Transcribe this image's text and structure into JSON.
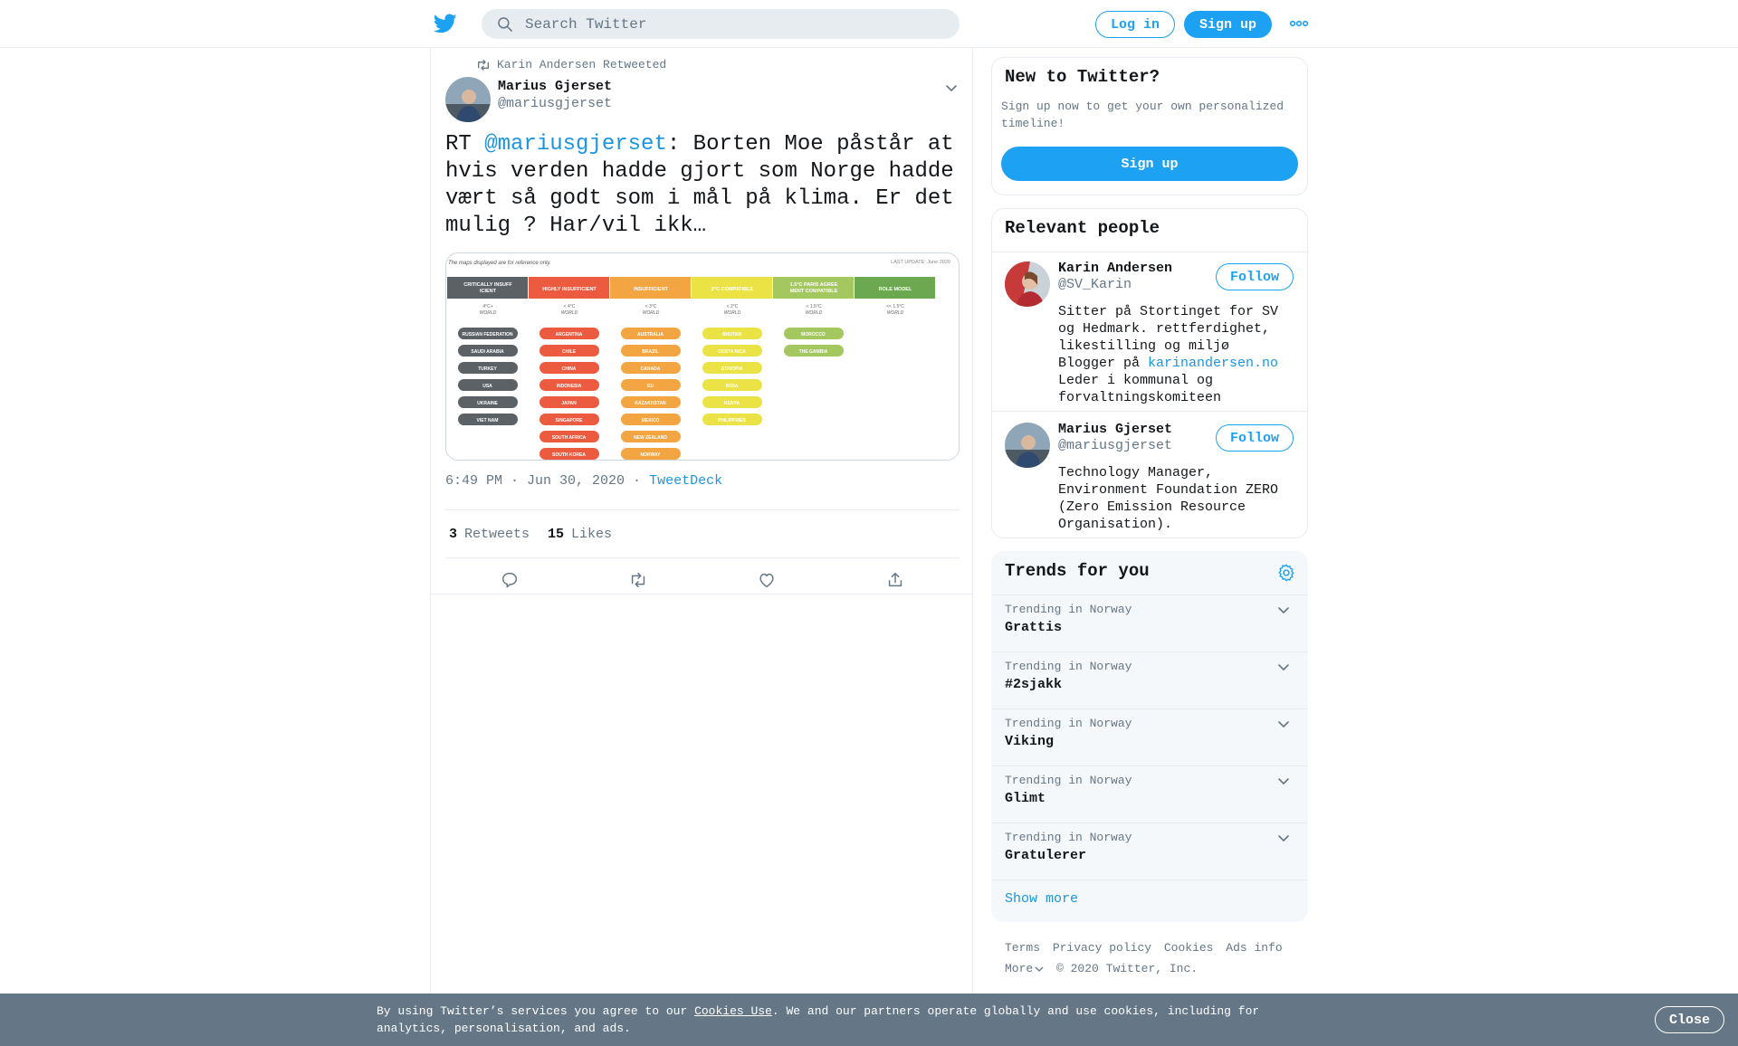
{
  "header": {
    "search_placeholder": "Search Twitter",
    "login_label": "Log in",
    "signup_label": "Sign up"
  },
  "tweet": {
    "retweeted_by": "Karin Andersen Retweeted",
    "author_name": "Marius Gjerset",
    "author_handle": "@mariusgjerset",
    "text_prefix": "RT ",
    "text_mention": "@mariusgjerset",
    "text_body": ": Borten Moe påstår at hvis verden hadde gjort som Norge hadde vært så godt som i mål på klima. Er det mulig ? Har/vil ikk…",
    "time": "6:49 PM · Jun 30, 2020",
    "time_sep": " · ",
    "source": "TweetDeck",
    "retweets_count": "3",
    "retweets_label": "Retweets",
    "likes_count": "15",
    "likes_label": "Likes"
  },
  "media": {
    "note": "The maps displayed are for reference only.",
    "last_update_label": "LAST UPDATE:",
    "last_update_value": "June 2020",
    "columns": [
      {
        "title": "CRITICALLY INSUFFICIENT",
        "sub1": "4°C+",
        "sub2": "WORLD",
        "color": "#5c6166",
        "items": [
          "RUSSIAN FEDERATION",
          "SAUDI ARABIA",
          "TURKEY",
          "USA",
          "UKRAINE",
          "VIET NAM"
        ]
      },
      {
        "title": "HIGHLY INSUFFICIENT",
        "sub1": "< 4°C",
        "sub2": "WORLD",
        "color": "#ec5b3f",
        "items": [
          "ARGENTINA",
          "CHILE",
          "CHINA",
          "INDONESIA",
          "JAPAN",
          "SINGAPORE",
          "SOUTH AFRICA",
          "SOUTH KOREA"
        ]
      },
      {
        "title": "INSUFFICIENT",
        "sub1": "< 3°C",
        "sub2": "WORLD",
        "color": "#f3a541",
        "items": [
          "AUSTRALIA",
          "BRAZIL",
          "CANADA",
          "EU",
          "KAZAKHSTAN",
          "MEXICO",
          "NEW ZEALAND",
          "NORWAY"
        ]
      },
      {
        "title": "2°C COMPATIBLE",
        "sub1": "< 2°C",
        "sub2": "WORLD",
        "color": "#ebe346",
        "items": [
          "BHUTAN",
          "COSTA RICA",
          "ETHIOPIA",
          "INDIA",
          "KENYA",
          "PHILIPPINES"
        ]
      },
      {
        "title": "1.5°C PARIS AGREEMENT COMPATIBLE",
        "sub1": "< 1.5°C",
        "sub2": "WORLD",
        "color": "#a5c760",
        "items": [
          "MOROCCO",
          "THE GAMBIA"
        ]
      },
      {
        "title": "ROLE MODEL",
        "sub1": "<< 1.5°C",
        "sub2": "WORLD",
        "color": "#6ba84f",
        "items": []
      }
    ]
  },
  "sidebar": {
    "signup_title": "New to Twitter?",
    "signup_text": "Sign up now to get your own personalized timeline!",
    "signup_button": "Sign up",
    "people_title": "Relevant people",
    "people": [
      {
        "name": "Karin Andersen",
        "handle": "@SV_Karin",
        "follow": "Follow",
        "bio_l1": "Sitter på Stortinget for SV",
        "bio_l2": "og Hedmark. rettferdighet,",
        "bio_l3": "likestilling og miljø",
        "bio_l4_prefix": "Blogger på ",
        "bio_l4_link": "karinandersen.no",
        "bio_l5": "Leder i kommunal og",
        "bio_l6": "forvaltningskomiteen"
      },
      {
        "name": "Marius Gjerset",
        "handle": "@mariusgjerset",
        "follow": "Follow",
        "bio_l1": "Technology Manager,",
        "bio_l2": "Environment Foundation ZERO",
        "bio_l3": "(Zero Emission Resource",
        "bio_l4": "Organisation)."
      }
    ],
    "trends_title": "Trends for you",
    "trends": [
      {
        "context": "Trending in Norway",
        "name": "Grattis"
      },
      {
        "context": "Trending in Norway",
        "name": "#2sjakk"
      },
      {
        "context": "Trending in Norway",
        "name": "Viking"
      },
      {
        "context": "Trending in Norway",
        "name": "Glimt"
      },
      {
        "context": "Trending in Norway",
        "name": "Gratulerer"
      }
    ],
    "show_more": "Show more",
    "footer": {
      "terms": "Terms",
      "privacy": "Privacy policy",
      "cookies": "Cookies",
      "ads": "Ads info",
      "more": "More",
      "copyright": "© 2020 Twitter, Inc."
    }
  },
  "cookie_bar": {
    "text_before": "By using Twitter’s services you agree to our ",
    "link": "Cookies Use",
    "text_after": ". We and our partners operate globally and use cookies, including for analytics, personalisation, and ads.",
    "close": "Close"
  },
  "colors": {
    "brand": "#1da1f2",
    "link": "#1b95e0",
    "secondary_text": "#657786",
    "cookie_bar": "#657786"
  }
}
